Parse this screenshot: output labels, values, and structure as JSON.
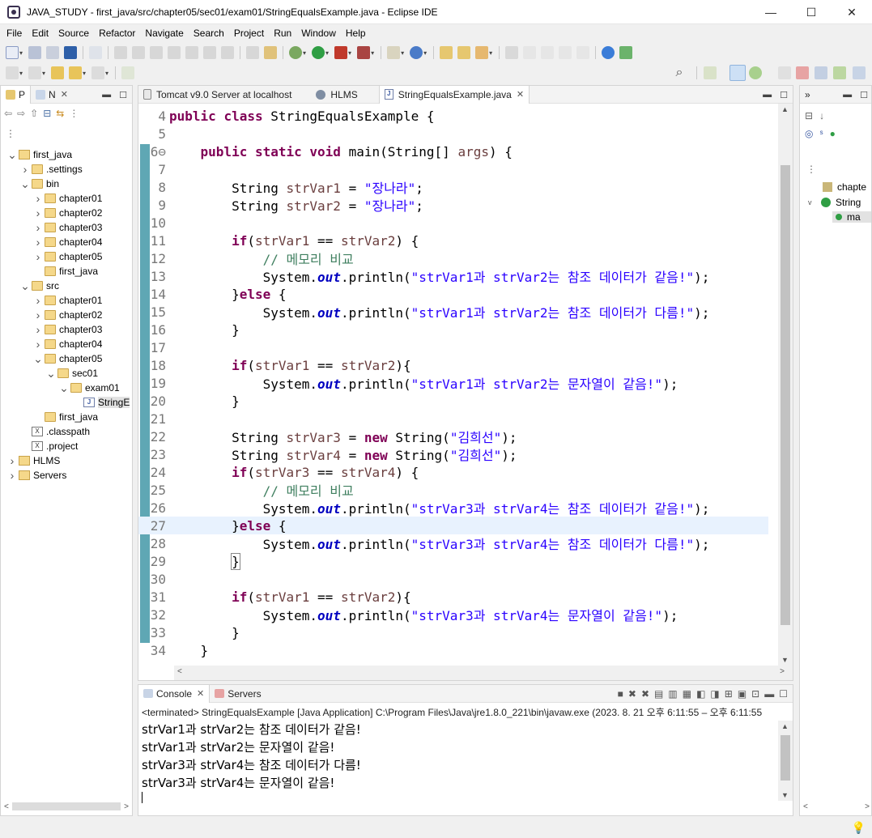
{
  "window": {
    "title": "JAVA_STUDY - first_java/src/chapter05/sec01/exam01/StringEqualsExample.java - Eclipse IDE",
    "minimize": "—",
    "maximize": "☐",
    "close": "✕"
  },
  "menu": [
    "File",
    "Edit",
    "Source",
    "Refactor",
    "Navigate",
    "Search",
    "Project",
    "Run",
    "Window",
    "Help"
  ],
  "explorer": {
    "tabs": [
      {
        "label": "P"
      },
      {
        "label": "N"
      }
    ],
    "tree": [
      {
        "label": "first_java",
        "depth": 0,
        "arrow": "v",
        "icon": "project"
      },
      {
        "label": ".settings",
        "depth": 1,
        "arrow": ">",
        "icon": "folder"
      },
      {
        "label": "bin",
        "depth": 1,
        "arrow": "v",
        "icon": "folder"
      },
      {
        "label": "chapter01",
        "depth": 2,
        "arrow": ">",
        "icon": "folder"
      },
      {
        "label": "chapter02",
        "depth": 2,
        "arrow": ">",
        "icon": "folder"
      },
      {
        "label": "chapter03",
        "depth": 2,
        "arrow": ">",
        "icon": "folder"
      },
      {
        "label": "chapter04",
        "depth": 2,
        "arrow": ">",
        "icon": "folder"
      },
      {
        "label": "chapter05",
        "depth": 2,
        "arrow": ">",
        "icon": "folder"
      },
      {
        "label": "first_java",
        "depth": 2,
        "arrow": "",
        "icon": "folder"
      },
      {
        "label": "src",
        "depth": 1,
        "arrow": "v",
        "icon": "folder"
      },
      {
        "label": "chapter01",
        "depth": 2,
        "arrow": ">",
        "icon": "folder"
      },
      {
        "label": "chapter02",
        "depth": 2,
        "arrow": ">",
        "icon": "folder"
      },
      {
        "label": "chapter03",
        "depth": 2,
        "arrow": ">",
        "icon": "folder"
      },
      {
        "label": "chapter04",
        "depth": 2,
        "arrow": ">",
        "icon": "folder"
      },
      {
        "label": "chapter05",
        "depth": 2,
        "arrow": "v",
        "icon": "folder"
      },
      {
        "label": "sec01",
        "depth": 3,
        "arrow": "v",
        "icon": "folder"
      },
      {
        "label": "exam01",
        "depth": 4,
        "arrow": "v",
        "icon": "folder"
      },
      {
        "label": "StringE",
        "depth": 5,
        "arrow": "",
        "icon": "java",
        "selected": true
      },
      {
        "label": "first_java",
        "depth": 2,
        "arrow": "",
        "icon": "folder"
      },
      {
        "label": ".classpath",
        "depth": 1,
        "arrow": "",
        "icon": "xml"
      },
      {
        "label": ".project",
        "depth": 1,
        "arrow": "",
        "icon": "xml"
      },
      {
        "label": "HLMS",
        "depth": 0,
        "arrow": ">",
        "icon": "project"
      },
      {
        "label": "Servers",
        "depth": 0,
        "arrow": ">",
        "icon": "project"
      }
    ]
  },
  "editor": {
    "tabs": [
      {
        "label": "Tomcat v9.0 Server at localhost",
        "active": false
      },
      {
        "label": "HLMS",
        "active": false
      },
      {
        "label": "StringEqualsExample.java",
        "active": true
      }
    ],
    "lines": [
      {
        "n": "4",
        "tokens": [
          [
            "kw",
            "public"
          ],
          [
            "",
            " "
          ],
          [
            "kw",
            "class"
          ],
          [
            "",
            " StringEqualsExample {"
          ]
        ]
      },
      {
        "n": "5",
        "tokens": []
      },
      {
        "n": "6⊖",
        "tokens": [
          [
            "",
            "    "
          ],
          [
            "kw",
            "public"
          ],
          [
            "",
            " "
          ],
          [
            "kw",
            "static"
          ],
          [
            "",
            " "
          ],
          [
            "kw",
            "void"
          ],
          [
            "",
            " main(String[] "
          ],
          [
            "var",
            "args"
          ],
          [
            "",
            ") {"
          ]
        ]
      },
      {
        "n": "7",
        "tokens": []
      },
      {
        "n": "8",
        "tokens": [
          [
            "",
            "        String "
          ],
          [
            "var",
            "strVar1"
          ],
          [
            "",
            " = "
          ],
          [
            "str",
            "\"장나라\""
          ],
          [
            "",
            ";"
          ]
        ]
      },
      {
        "n": "9",
        "tokens": [
          [
            "",
            "        String "
          ],
          [
            "var",
            "strVar2"
          ],
          [
            "",
            " = "
          ],
          [
            "str",
            "\"장나라\""
          ],
          [
            "",
            ";"
          ]
        ]
      },
      {
        "n": "10",
        "tokens": []
      },
      {
        "n": "11",
        "tokens": [
          [
            "",
            "        "
          ],
          [
            "kw",
            "if"
          ],
          [
            "",
            "("
          ],
          [
            "var",
            "strVar1"
          ],
          [
            "",
            " == "
          ],
          [
            "var",
            "strVar2"
          ],
          [
            "",
            ") {"
          ]
        ]
      },
      {
        "n": "12",
        "tokens": [
          [
            "",
            "            "
          ],
          [
            "cmt",
            "// 메모리 비교"
          ]
        ]
      },
      {
        "n": "13",
        "tokens": [
          [
            "",
            "            System."
          ],
          [
            "fld",
            "out"
          ],
          [
            "",
            ".println("
          ],
          [
            "str",
            "\"strVar1과 strVar2는 참조 데이터가 같음!\""
          ],
          [
            "",
            ");"
          ]
        ]
      },
      {
        "n": "14",
        "tokens": [
          [
            "",
            "        }"
          ],
          [
            "kw",
            "else"
          ],
          [
            "",
            " {"
          ]
        ]
      },
      {
        "n": "15",
        "tokens": [
          [
            "",
            "            System."
          ],
          [
            "fld",
            "out"
          ],
          [
            "",
            ".println("
          ],
          [
            "str",
            "\"strVar1과 strVar2는 참조 데이터가 다름!\""
          ],
          [
            "",
            ");"
          ]
        ]
      },
      {
        "n": "16",
        "tokens": [
          [
            "",
            "        }"
          ]
        ]
      },
      {
        "n": "17",
        "tokens": []
      },
      {
        "n": "18",
        "tokens": [
          [
            "",
            "        "
          ],
          [
            "kw",
            "if"
          ],
          [
            "",
            "("
          ],
          [
            "var",
            "strVar1"
          ],
          [
            "",
            " == "
          ],
          [
            "var",
            "strVar2"
          ],
          [
            "",
            "){"
          ]
        ]
      },
      {
        "n": "19",
        "tokens": [
          [
            "",
            "            System."
          ],
          [
            "fld",
            "out"
          ],
          [
            "",
            ".println("
          ],
          [
            "str",
            "\"strVar1과 strVar2는 문자열이 같음!\""
          ],
          [
            "",
            ");"
          ]
        ]
      },
      {
        "n": "20",
        "tokens": [
          [
            "",
            "        }"
          ]
        ]
      },
      {
        "n": "21",
        "tokens": []
      },
      {
        "n": "22",
        "tokens": [
          [
            "",
            "        String "
          ],
          [
            "var",
            "strVar3"
          ],
          [
            "",
            " = "
          ],
          [
            "kw",
            "new"
          ],
          [
            "",
            " String("
          ],
          [
            "str",
            "\"김희선\""
          ],
          [
            "",
            ");"
          ]
        ]
      },
      {
        "n": "23",
        "tokens": [
          [
            "",
            "        String "
          ],
          [
            "var",
            "strVar4"
          ],
          [
            "",
            " = "
          ],
          [
            "kw",
            "new"
          ],
          [
            "",
            " String("
          ],
          [
            "str",
            "\"김희선\""
          ],
          [
            "",
            ");"
          ]
        ]
      },
      {
        "n": "24",
        "tokens": [
          [
            "",
            "        "
          ],
          [
            "kw",
            "if"
          ],
          [
            "",
            "("
          ],
          [
            "var",
            "strVar3"
          ],
          [
            "",
            " == "
          ],
          [
            "var",
            "strVar4"
          ],
          [
            "",
            ") {"
          ]
        ]
      },
      {
        "n": "25",
        "tokens": [
          [
            "",
            "            "
          ],
          [
            "cmt",
            "// 메모리 비교"
          ]
        ]
      },
      {
        "n": "26",
        "tokens": [
          [
            "",
            "            System."
          ],
          [
            "fld",
            "out"
          ],
          [
            "",
            ".println("
          ],
          [
            "str",
            "\"strVar3과 strVar4는 참조 데이터가 같음!\""
          ],
          [
            "",
            ");"
          ]
        ]
      },
      {
        "n": "27",
        "tokens": [
          [
            "",
            "        }"
          ],
          [
            "kw",
            "else"
          ],
          [
            "",
            " {"
          ]
        ],
        "highlight": true
      },
      {
        "n": "28",
        "tokens": [
          [
            "",
            "            System."
          ],
          [
            "fld",
            "out"
          ],
          [
            "",
            ".println("
          ],
          [
            "str",
            "\"strVar3과 strVar4는 참조 데이터가 다름!\""
          ],
          [
            "",
            ");"
          ]
        ]
      },
      {
        "n": "29",
        "tokens": [
          [
            "",
            "        "
          ],
          [
            "box",
            "}"
          ]
        ]
      },
      {
        "n": "30",
        "tokens": []
      },
      {
        "n": "31",
        "tokens": [
          [
            "",
            "        "
          ],
          [
            "kw",
            "if"
          ],
          [
            "",
            "("
          ],
          [
            "var",
            "strVar1"
          ],
          [
            "",
            " == "
          ],
          [
            "var",
            "strVar2"
          ],
          [
            "",
            "){"
          ]
        ]
      },
      {
        "n": "32",
        "tokens": [
          [
            "",
            "            System."
          ],
          [
            "fld",
            "out"
          ],
          [
            "",
            ".println("
          ],
          [
            "str",
            "\"strVar3과 strVar4는 문자열이 같음!\""
          ],
          [
            "",
            ");"
          ]
        ]
      },
      {
        "n": "33",
        "tokens": [
          [
            "",
            "        }"
          ]
        ]
      },
      {
        "n": "34",
        "tokens": [
          [
            "",
            "    }"
          ]
        ]
      }
    ]
  },
  "console": {
    "tabs": [
      {
        "label": "Console",
        "active": true
      },
      {
        "label": "Servers",
        "active": false
      }
    ],
    "header": "<terminated> StringEqualsExample [Java Application] C:\\Program Files\\Java\\jre1.8.0_221\\bin\\javaw.exe  (2023. 8. 21 오후 6:11:55 – 오후 6:11:55",
    "output": [
      "strVar1과 strVar2는 참조 데이터가 같음!",
      "strVar1과 strVar2는 문자열이 같음!",
      "strVar3과 strVar4는 참조 데이터가 다름!",
      "strVar3과 strVar4는 문자열이 같음!"
    ]
  },
  "outline": {
    "items": [
      {
        "label": "chapte"
      },
      {
        "label": "String"
      },
      {
        "label": "ma"
      }
    ]
  },
  "colors": {
    "keyword": "#7f0055",
    "string": "#2a00ff",
    "comment": "#3f7f5f",
    "field": "#0000c0",
    "variable": "#6a3e3e",
    "line_highlight": "#e8f2fe"
  }
}
